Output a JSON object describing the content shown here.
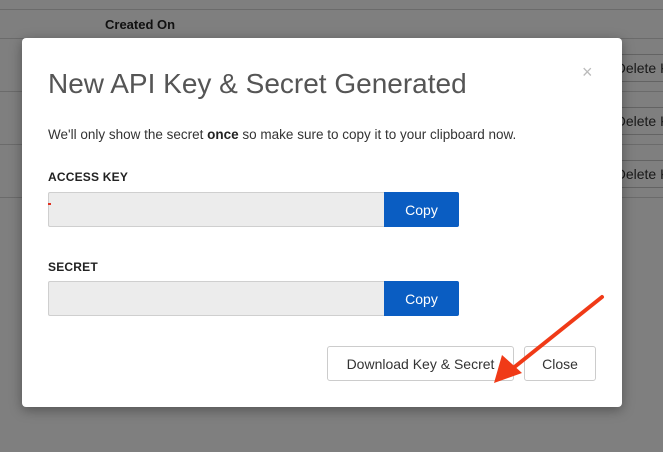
{
  "background": {
    "table_header": {
      "created_on": "Created On"
    },
    "rows": [
      {
        "action_label": "Delete Key"
      },
      {
        "action_label": "Delete Key"
      },
      {
        "action_label": "Delete Key"
      }
    ]
  },
  "modal": {
    "title": "New API Key & Secret Generated",
    "close_symbol": "×",
    "intro_before": "We'll only show the secret ",
    "intro_emphasis": "once",
    "intro_after": " so make sure to copy it to your clipboard now.",
    "access_key": {
      "label": "ACCESS KEY",
      "value": "",
      "copy_label": "Copy"
    },
    "secret": {
      "label": "SECRET",
      "value": "",
      "copy_label": "Copy"
    },
    "download_label": "Download Key & Secret",
    "close_label": "Close"
  },
  "annotation": {
    "arrow_color": "#f03a17"
  },
  "colors": {
    "copy_button": "#0a5dc2",
    "backdrop": "rgba(0,0,0,0.5)"
  }
}
